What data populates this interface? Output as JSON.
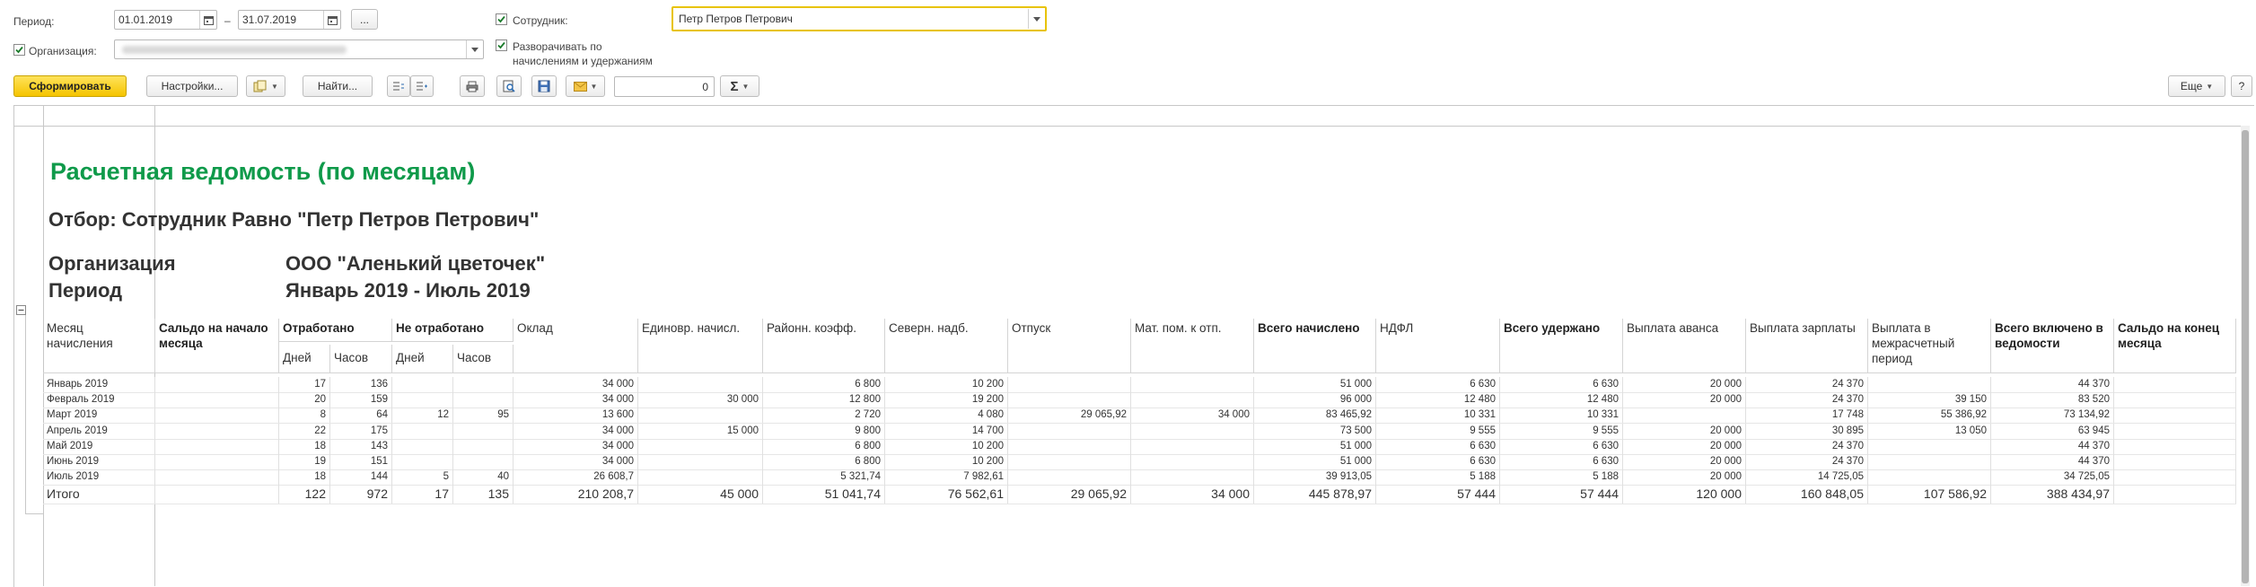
{
  "filters": {
    "period_label": "Период:",
    "period_from": "01.01.2019",
    "period_dash": "–",
    "period_to": "31.07.2019",
    "period_choose": "...",
    "employee_label": "Сотрудник:",
    "employee_checked": true,
    "employee_value": "Петр Петров Петрович",
    "org_label": "Организация:",
    "org_checked": true,
    "org_value": "",
    "expand_label_line1": "Разворачивать по",
    "expand_label_line2": "начислениям и удержаниям",
    "expand_checked": true
  },
  "toolbar": {
    "generate": "Сформировать",
    "settings": "Настройки...",
    "find": "Найти...",
    "number_value": "0",
    "more": "Еще",
    "help": "?"
  },
  "report": {
    "title": "Расчетная ведомость (по месяцам)",
    "filter_text": "Отбор: Сотрудник Равно \"Петр Петров Петрович\"",
    "org_label": "Организация",
    "org_value": "ООО \"Аленький цветочек\"",
    "period_label": "Период",
    "period_value": "Январь 2019 - Июль 2019",
    "columns": {
      "month": "Месяц начисления",
      "opening": "Сальдо на начало месяца",
      "worked": "Отработано",
      "worked_days": "Дней",
      "worked_hours": "Часов",
      "not_worked": "Не отработано",
      "not_worked_days": "Дней",
      "not_worked_hours": "Часов",
      "salary": "Оклад",
      "one_time": "Единовр. начисл.",
      "regional": "Районн. коэфф.",
      "northern": "Северн. надб.",
      "vacation": "Отпуск",
      "mat_help": "Мат. пом. к отп.",
      "total_accrued": "Всего начислено",
      "ndfl": "НДФЛ",
      "total_withheld": "Всего удержано",
      "advance": "Выплата аванса",
      "salary_payment": "Выплата зарплаты",
      "interim_payment": "Выплата в межрасчетный период",
      "total_included": "Всего включено в ведомости",
      "closing": "Сальдо на конец месяца"
    },
    "rows": [
      [
        "Январь 2019",
        "",
        "17",
        "136",
        "",
        "",
        "34 000",
        "",
        "6 800",
        "10 200",
        "",
        "",
        "51 000",
        "6 630",
        "6 630",
        "20 000",
        "24 370",
        "",
        "44 370",
        ""
      ],
      [
        "Февраль 2019",
        "",
        "20",
        "159",
        "",
        "",
        "34 000",
        "30 000",
        "12 800",
        "19 200",
        "",
        "",
        "96 000",
        "12 480",
        "12 480",
        "20 000",
        "24 370",
        "39 150",
        "83 520",
        ""
      ],
      [
        "Март 2019",
        "",
        "8",
        "64",
        "12",
        "95",
        "13 600",
        "",
        "2 720",
        "4 080",
        "29 065,92",
        "34 000",
        "83 465,92",
        "10 331",
        "10 331",
        "",
        "17 748",
        "55 386,92",
        "73 134,92",
        ""
      ],
      [
        "Апрель 2019",
        "",
        "22",
        "175",
        "",
        "",
        "34 000",
        "15 000",
        "9 800",
        "14 700",
        "",
        "",
        "73 500",
        "9 555",
        "9 555",
        "20 000",
        "30 895",
        "13 050",
        "63 945",
        ""
      ],
      [
        "Май 2019",
        "",
        "18",
        "143",
        "",
        "",
        "34 000",
        "",
        "6 800",
        "10 200",
        "",
        "",
        "51 000",
        "6 630",
        "6 630",
        "20 000",
        "24 370",
        "",
        "44 370",
        ""
      ],
      [
        "Июнь 2019",
        "",
        "19",
        "151",
        "",
        "",
        "34 000",
        "",
        "6 800",
        "10 200",
        "",
        "",
        "51 000",
        "6 630",
        "6 630",
        "20 000",
        "24 370",
        "",
        "44 370",
        ""
      ],
      [
        "Июль 2019",
        "",
        "18",
        "144",
        "5",
        "40",
        "26 608,7",
        "",
        "5 321,74",
        "7 982,61",
        "",
        "",
        "39 913,05",
        "5 188",
        "5 188",
        "20 000",
        "14 725,05",
        "",
        "34 725,05",
        ""
      ]
    ],
    "total": [
      "Итого",
      "",
      "122",
      "972",
      "17",
      "135",
      "210 208,7",
      "45 000",
      "51 041,74",
      "76 562,61",
      "29 065,92",
      "34 000",
      "445 878,97",
      "57 444",
      "57 444",
      "120 000",
      "160 848,05",
      "107 586,92",
      "388 434,97",
      ""
    ]
  },
  "colors": {
    "title_green": "#0f9a4a",
    "primary_yellow": "#f5c400"
  },
  "icons": [
    "calendar-icon",
    "dropdown-icon",
    "checkbox-checked-icon",
    "copy-icon",
    "collapse-all-icon",
    "expand-all-icon",
    "print-icon",
    "preview-icon",
    "save-icon",
    "mail-icon",
    "sum-icon",
    "collapse-group-icon"
  ]
}
